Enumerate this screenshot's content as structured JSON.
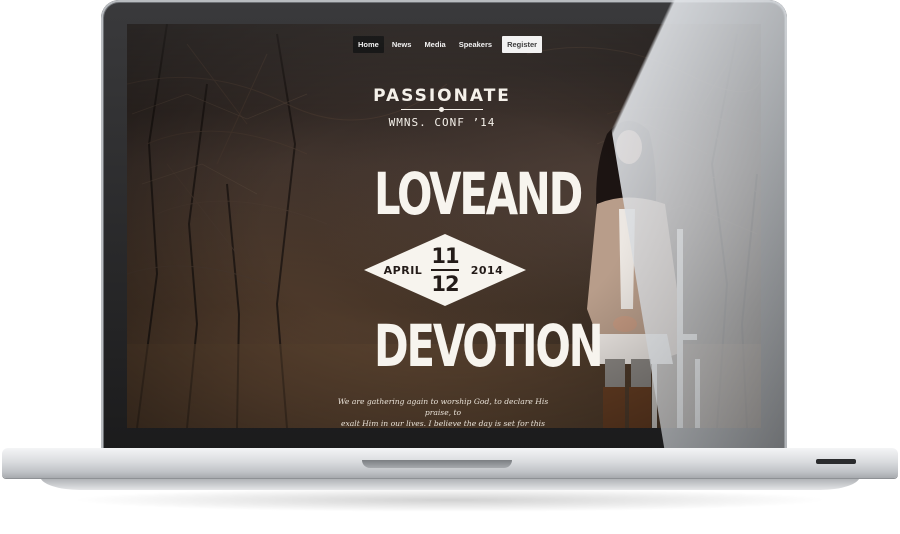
{
  "nav": {
    "items": [
      {
        "label": "Home",
        "active": true
      },
      {
        "label": "News",
        "active": false
      },
      {
        "label": "Media",
        "active": false
      },
      {
        "label": "Speakers",
        "active": false
      }
    ],
    "register_label": "Register"
  },
  "brand": {
    "name": "PASSIONATE",
    "subtitle": "WMNS. CONF ’14"
  },
  "hero": {
    "title_line1": "LOVEAND",
    "title_line2": "DEVOTION",
    "date": {
      "month": "APRIL",
      "day_start": "11",
      "day_end": "12",
      "year": "2014"
    },
    "blurb_line1": "We are gathering again to worship God, to declare His praise, to",
    "blurb_line2": "exalt Him in our lives. I believe the day is set for this generation"
  },
  "colors": {
    "nav_active_bg": "#0c0c0c",
    "register_bg": "#f1f1f1",
    "hero_text": "#f7f4ee",
    "diamond_fill": "#f7f4ee",
    "date_text": "#241c19",
    "screen_bg": "#2c2522"
  },
  "icons": {
    "device": "laptop-frame"
  }
}
